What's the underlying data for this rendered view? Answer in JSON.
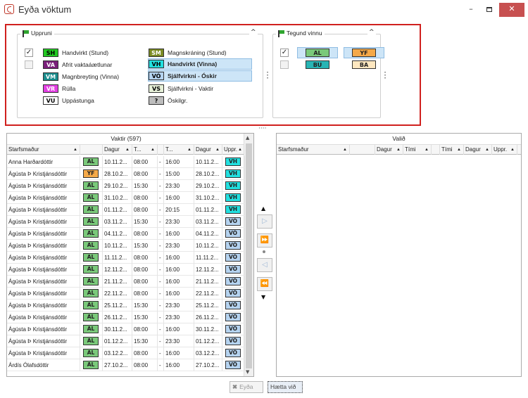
{
  "window": {
    "title": "Eyða vöktum",
    "minimize": "–",
    "close": "✕"
  },
  "filters": {
    "origin": {
      "label": "Uppruni",
      "items": [
        {
          "code": "SH",
          "label": "Handvirkt (Stund)",
          "bg": "#22c922",
          "fg": "#000000",
          "checked": true
        },
        {
          "code": "VA",
          "label": "Afrit vaktaáætlunar",
          "bg": "#7a1f7a",
          "fg": "#ffffff",
          "checked": false
        },
        {
          "code": "VM",
          "label": "Magnbreyting (Vinna)",
          "bg": "#1b8d8d",
          "fg": "#ffffff",
          "checked": null
        },
        {
          "code": "VR",
          "label": "Rúlla",
          "bg": "#e23fe2",
          "fg": "#ffffff",
          "checked": null
        },
        {
          "code": "VU",
          "label": "Uppástunga",
          "bg": "#ffffff",
          "fg": "#000000",
          "checked": null
        },
        {
          "code": "SM",
          "label": "Magnskráning (Stund)",
          "bg": "#7a8a22",
          "fg": "#ffffff",
          "checked": null
        },
        {
          "code": "VH",
          "label": "Handvirkt (Vinna)",
          "bg": "#22e0e0",
          "fg": "#000000",
          "checked": null
        },
        {
          "code": "VÓ",
          "label": "Sjálfvirkni - Óskir",
          "bg": "#b5d3f0",
          "fg": "#000000",
          "checked": null
        },
        {
          "code": "VS",
          "label": "Sjálfvirkni - Vaktir",
          "bg": "#e6f0d8",
          "fg": "#000000",
          "checked": null
        },
        {
          "code": "?",
          "label": "Óskilgr.",
          "bg": "#bdbdbd",
          "fg": "#000000",
          "checked": null
        }
      ]
    },
    "worktype": {
      "label": "Tegund vinnu",
      "rows": [
        {
          "checked": true,
          "left": {
            "code": "AL",
            "bg": "#7ac97a"
          },
          "right": {
            "code": "YF",
            "bg": "#f5a948"
          }
        },
        {
          "checked": false,
          "left": {
            "code": "BU",
            "bg": "#28b5b5"
          },
          "right": {
            "code": "BA",
            "bg": "#fde7c0"
          }
        }
      ]
    }
  },
  "shifts": {
    "title": "Vaktir (597)",
    "columns": [
      "Starfsmaður",
      "Dagur",
      "T...",
      "T...",
      "Dagur",
      "Uppr."
    ],
    "rows": [
      {
        "name": "Anna Harðardóttir",
        "type": "AL",
        "date1": "10.11.2...",
        "t1": "08:00",
        "t2": "16:00",
        "date2": "10.11.2...",
        "origin": "VH"
      },
      {
        "name": "Ágústa Þ Kristjánsdóttir",
        "type": "YF",
        "date1": "28.10.2...",
        "t1": "08:00",
        "t2": "15:00",
        "date2": "28.10.2...",
        "origin": "VH"
      },
      {
        "name": "Ágústa Þ Kristjánsdóttir",
        "type": "AL",
        "date1": "29.10.2...",
        "t1": "15:30",
        "t2": "23:30",
        "date2": "29.10.2...",
        "origin": "VH"
      },
      {
        "name": "Ágústa Þ Kristjánsdóttir",
        "type": "AL",
        "date1": "31.10.2...",
        "t1": "08:00",
        "t2": "16:00",
        "date2": "31.10.2...",
        "origin": "VH"
      },
      {
        "name": "Ágústa Þ Kristjánsdóttir",
        "type": "AL",
        "date1": "01.11.2...",
        "t1": "08:00",
        "t2": "20:15",
        "date2": "01.11.2...",
        "origin": "VH"
      },
      {
        "name": "Ágústa Þ Kristjánsdóttir",
        "type": "AL",
        "date1": "03.11.2...",
        "t1": "15:30",
        "t2": "23:30",
        "date2": "03.11.2...",
        "origin": "VÓ"
      },
      {
        "name": "Ágústa Þ Kristjánsdóttir",
        "type": "AL",
        "date1": "04.11.2...",
        "t1": "08:00",
        "t2": "16:00",
        "date2": "04.11.2...",
        "origin": "VÓ"
      },
      {
        "name": "Ágústa Þ Kristjánsdóttir",
        "type": "AL",
        "date1": "10.11.2...",
        "t1": "15:30",
        "t2": "23:30",
        "date2": "10.11.2...",
        "origin": "VÓ"
      },
      {
        "name": "Ágústa Þ Kristjánsdóttir",
        "type": "AL",
        "date1": "11.11.2...",
        "t1": "08:00",
        "t2": "16:00",
        "date2": "11.11.2...",
        "origin": "VÓ"
      },
      {
        "name": "Ágústa Þ Kristjánsdóttir",
        "type": "AL",
        "date1": "12.11.2...",
        "t1": "08:00",
        "t2": "16:00",
        "date2": "12.11.2...",
        "origin": "VÓ"
      },
      {
        "name": "Ágústa Þ Kristjánsdóttir",
        "type": "AL",
        "date1": "21.11.2...",
        "t1": "08:00",
        "t2": "16:00",
        "date2": "21.11.2...",
        "origin": "VÓ"
      },
      {
        "name": "Ágústa Þ Kristjánsdóttir",
        "type": "AL",
        "date1": "22.11.2...",
        "t1": "08:00",
        "t2": "16:00",
        "date2": "22.11.2...",
        "origin": "VÓ"
      },
      {
        "name": "Ágústa Þ Kristjánsdóttir",
        "type": "AL",
        "date1": "25.11.2...",
        "t1": "15:30",
        "t2": "23:30",
        "date2": "25.11.2...",
        "origin": "VÓ"
      },
      {
        "name": "Ágústa Þ Kristjánsdóttir",
        "type": "AL",
        "date1": "26.11.2...",
        "t1": "15:30",
        "t2": "23:30",
        "date2": "26.11.2...",
        "origin": "VÓ"
      },
      {
        "name": "Ágústa Þ Kristjánsdóttir",
        "type": "AL",
        "date1": "30.11.2...",
        "t1": "08:00",
        "t2": "16:00",
        "date2": "30.11.2...",
        "origin": "VÓ"
      },
      {
        "name": "Ágústa Þ Kristjánsdóttir",
        "type": "AL",
        "date1": "01.12.2...",
        "t1": "15:30",
        "t2": "23:30",
        "date2": "01.12.2...",
        "origin": "VÓ"
      },
      {
        "name": "Ágústa Þ Kristjánsdóttir",
        "type": "AL",
        "date1": "03.12.2...",
        "t1": "08:00",
        "t2": "16:00",
        "date2": "03.12.2...",
        "origin": "VÓ"
      },
      {
        "name": "Árdís Ólafsdóttir",
        "type": "AL",
        "date1": "27.10.2...",
        "t1": "08:00",
        "t2": "16:00",
        "date2": "27.10.2...",
        "origin": "VÓ"
      }
    ]
  },
  "selected": {
    "title": "Valið",
    "columns": [
      "Starfsmaður",
      "Dagur",
      "Tími",
      "Tími",
      "Dagur",
      "Uppr."
    ]
  },
  "badge_colors": {
    "AL": "#7ac97a",
    "YF": "#f5a948",
    "VH": "#22e0e0",
    "VÓ": "#b5d3f0"
  },
  "buttons": {
    "delete": "Eyða",
    "cancel": "Hætta við"
  }
}
